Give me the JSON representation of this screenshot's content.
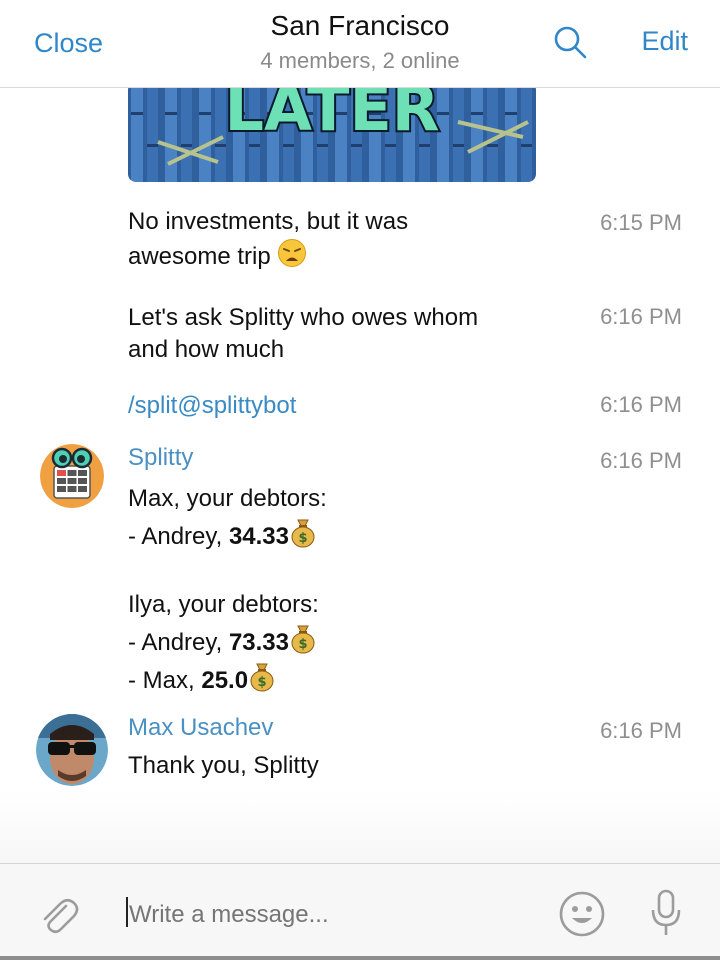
{
  "header": {
    "close_label": "Close",
    "title": "San Francisco",
    "subtitle": "4 members, 2 online",
    "edit_label": "Edit"
  },
  "sticker": {
    "text": "LATER"
  },
  "messages": [
    {
      "text_line1": "No investments, but it was",
      "text_line2": "awesome trip",
      "emoji": "weary-face",
      "time": "6:15 PM"
    },
    {
      "text_line1": "Let's ask Splitty who owes whom",
      "text_line2": "and how much",
      "time": "6:16 PM"
    },
    {
      "command": "/split@splittybot",
      "time": "6:16 PM"
    },
    {
      "sender": "Splitty",
      "time": "6:16 PM",
      "avatar": "splitty-bot-avatar",
      "line1": "Max, your debtors:",
      "line2_prefix": "- Andrey, ",
      "line2_amount": "34.33",
      "line3": "Ilya, your debtors:",
      "line4_prefix": "- Andrey, ",
      "line4_amount": "73.33",
      "line5_prefix": "- Max, ",
      "line5_amount": "25.0",
      "emoji": "money-bag"
    },
    {
      "sender": "Max Usachev",
      "time": "6:16 PM",
      "avatar": "max-usachev-avatar",
      "text": "Thank you, Splitty"
    }
  ],
  "input": {
    "placeholder": "Write a message..."
  },
  "icons": {
    "attach": "paperclip-icon",
    "search": "search-icon",
    "emoji": "smiley-icon",
    "mic": "microphone-icon"
  },
  "colors": {
    "accent": "#2f86c9",
    "sender": "#4a90c2",
    "time": "#8f8f8f"
  }
}
